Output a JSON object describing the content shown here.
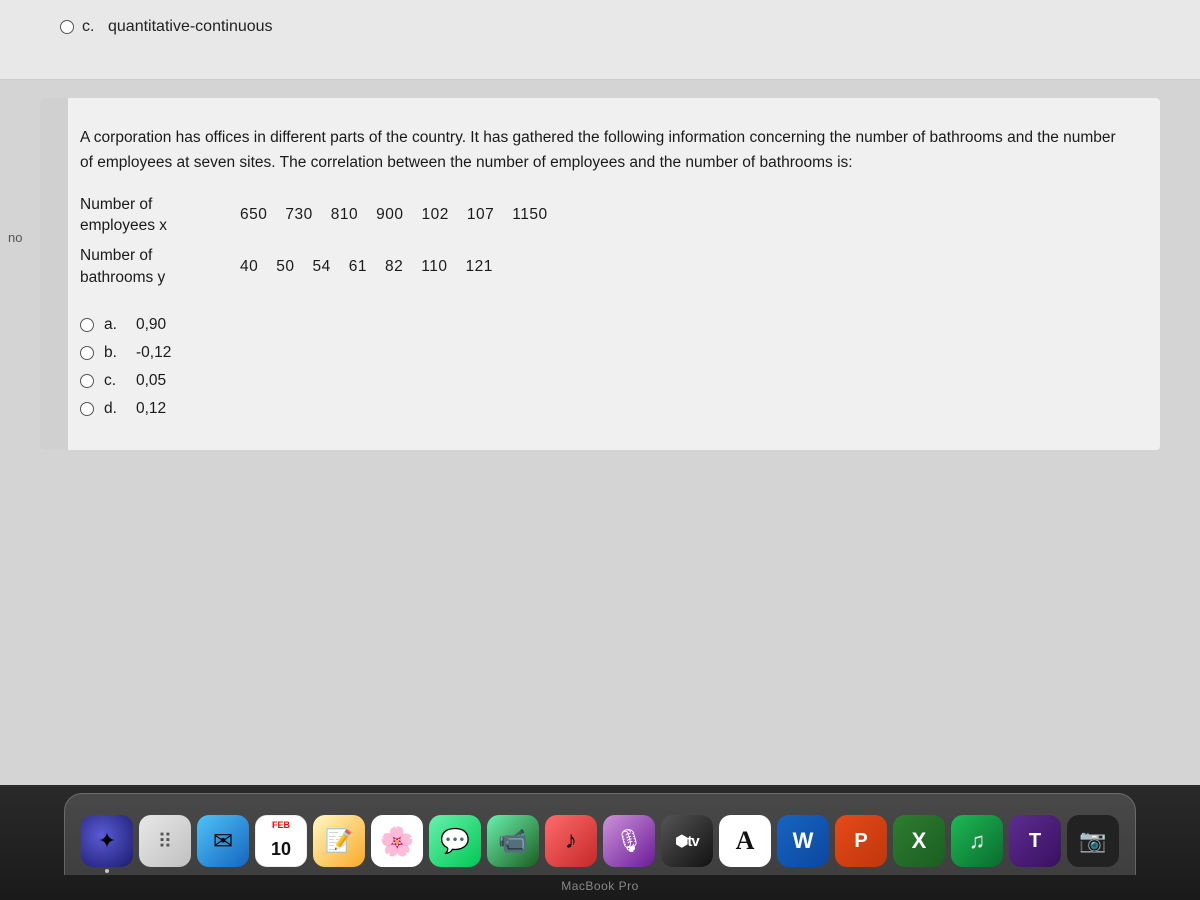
{
  "page": {
    "bg_color": "#d0d0d0"
  },
  "top_option": {
    "letter": "c.",
    "text": "quantitative-continuous"
  },
  "question": {
    "body": "A corporation has offices in different parts of the country. It has gathered the following information concerning the number of bathrooms and the number of employees at seven sites. The correlation between the number of employees and the number of bathrooms is:",
    "row1_label_line1": "Number of",
    "row1_label_line2": "employees x",
    "row1_values": [
      "650",
      "730",
      "810",
      "900",
      "102",
      "107",
      "1150"
    ],
    "row2_label_line1": "Number of",
    "row2_label_line2": "bathrooms y",
    "row2_values": [
      "40",
      "50",
      "54",
      "61",
      "82",
      "110",
      "121"
    ]
  },
  "options": [
    {
      "letter": "a.",
      "value": "0,90"
    },
    {
      "letter": "b.",
      "value": "-0,12"
    },
    {
      "letter": "c.",
      "value": "0,05"
    },
    {
      "letter": "d.",
      "value": "0,12"
    }
  ],
  "dock": {
    "items": [
      {
        "id": "siri",
        "label": "Siri",
        "month": "",
        "day": ""
      },
      {
        "id": "launchpad",
        "label": "Launchpad"
      },
      {
        "id": "mail",
        "label": "Mail"
      },
      {
        "id": "calendar",
        "label": "Calendar",
        "month": "FEB",
        "day": "10"
      },
      {
        "id": "notes",
        "label": "Notes"
      },
      {
        "id": "photos",
        "label": "Photos"
      },
      {
        "id": "messages",
        "label": "Messages"
      },
      {
        "id": "facetime",
        "label": "FaceTime"
      },
      {
        "id": "music",
        "label": "Music"
      },
      {
        "id": "podcasts",
        "label": "Podcasts"
      },
      {
        "id": "tv",
        "label": "Apple TV"
      },
      {
        "id": "font",
        "label": "Font Book"
      },
      {
        "id": "word",
        "label": "Microsoft Word"
      },
      {
        "id": "powerpoint",
        "label": "PowerPoint"
      },
      {
        "id": "excel",
        "label": "Excel"
      },
      {
        "id": "spotify",
        "label": "Spotify"
      },
      {
        "id": "teams",
        "label": "Microsoft Teams"
      },
      {
        "id": "camera",
        "label": "Camera"
      }
    ],
    "macbook_label": "MacBook Pro"
  }
}
